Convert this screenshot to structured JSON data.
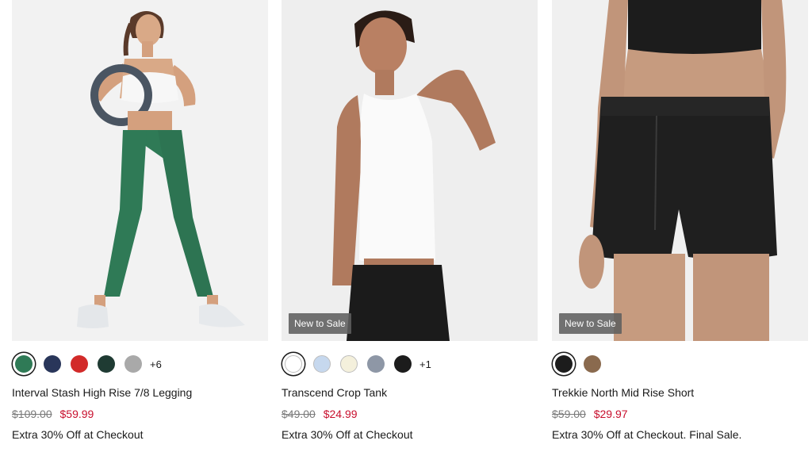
{
  "products": [
    {
      "name": "Interval Stash High Rise 7/8 Legging",
      "original_price": "$109.00",
      "sale_price": "$59.99",
      "promo": "Extra 30% Off at Checkout",
      "badge": "",
      "swatches": [
        {
          "name": "green",
          "color": "#2f7a56"
        },
        {
          "name": "navy",
          "color": "#29365a"
        },
        {
          "name": "red",
          "color": "#d22a29"
        },
        {
          "name": "dark-green",
          "color": "#1f3b33"
        },
        {
          "name": "grey",
          "color": "#a9a9a9"
        }
      ],
      "more_colors": "+6"
    },
    {
      "name": "Transcend Crop Tank",
      "original_price": "$49.00",
      "sale_price": "$24.99",
      "promo": "Extra 30% Off at Checkout",
      "badge": "New to Sale",
      "swatches": [
        {
          "name": "white",
          "color": "#ffffff"
        },
        {
          "name": "light-blue",
          "color": "#c6d8ee"
        },
        {
          "name": "cream",
          "color": "#f4f0dc"
        },
        {
          "name": "slate",
          "color": "#8e97a6"
        },
        {
          "name": "black",
          "color": "#1c1c1c"
        }
      ],
      "more_colors": "+1"
    },
    {
      "name": "Trekkie North Mid Rise Short",
      "original_price": "$59.00",
      "sale_price": "$29.97",
      "promo": "Extra 30% Off at Checkout. Final Sale.",
      "badge": "New to Sale",
      "swatches": [
        {
          "name": "black",
          "color": "#1c1c1c"
        },
        {
          "name": "brown",
          "color": "#8a6a4e"
        }
      ],
      "more_colors": ""
    }
  ]
}
